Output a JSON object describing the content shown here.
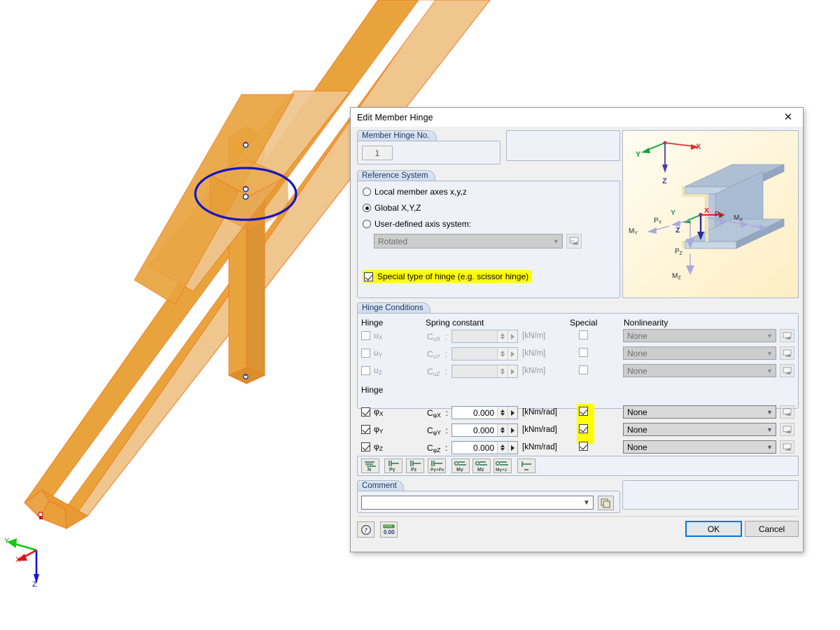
{
  "viewport": {
    "axis_indicator": {
      "x_label": "X",
      "y_label": "Y",
      "z_label": "Z"
    },
    "model": {
      "selection_marker": "blue-ellipse",
      "member_color": "#E8A33D"
    }
  },
  "dialog": {
    "title": "Edit Member Hinge",
    "close_icon": "✕",
    "hinge_no": {
      "label": "Member Hinge No.",
      "value": "1"
    },
    "reference_system": {
      "label": "Reference System",
      "options": [
        {
          "label": "Local member axes x,y,z",
          "selected": false
        },
        {
          "label": "Global X,Y,Z",
          "selected": true
        },
        {
          "label": "User-defined axis system:",
          "selected": false
        }
      ],
      "axis_select": {
        "value": "Rotated",
        "enabled": false
      },
      "special_hinge": {
        "label": "Special type of hinge (e.g. scissor hinge)",
        "checked": true,
        "highlight": "#ffff00"
      }
    },
    "graphic": {
      "axes": [
        {
          "label": "X",
          "color": "#e03030"
        },
        {
          "label": "Y",
          "color": "#13a03c"
        },
        {
          "label": "Z",
          "color": "#4b3ea8"
        }
      ],
      "forces": [
        "P",
        "X",
        "P",
        "Y",
        "P",
        "Z"
      ],
      "labels": [
        {
          "text": "P",
          "sub": "X"
        },
        {
          "text": "P",
          "sub": "Y"
        },
        {
          "text": "P",
          "sub": "Z"
        },
        {
          "text": "M",
          "sub": "X"
        },
        {
          "text": "M",
          "sub": "Y"
        },
        {
          "text": "M",
          "sub": "Z"
        }
      ]
    },
    "hinge_conditions": {
      "label": "Hinge Conditions",
      "columns": {
        "hinge": "Hinge",
        "spring": "Spring constant",
        "special": "Special",
        "nonlinearity": "Nonlinearity"
      },
      "subheader": "Hinge",
      "translation_rows": [
        {
          "dof": "u",
          "sub": "X",
          "checked": false,
          "enabled": false,
          "spring_symbol": "C",
          "spring_sub": "uX",
          "spring_value": "",
          "unit": "[kN/m]",
          "special": false,
          "special_enabled": false,
          "nonlinearity": "None"
        },
        {
          "dof": "u",
          "sub": "Y",
          "checked": false,
          "enabled": false,
          "spring_symbol": "C",
          "spring_sub": "uY",
          "spring_value": "",
          "unit": "[kN/m]",
          "special": false,
          "special_enabled": false,
          "nonlinearity": "None"
        },
        {
          "dof": "u",
          "sub": "Z",
          "checked": false,
          "enabled": false,
          "spring_symbol": "C",
          "spring_sub": "uZ",
          "spring_value": "",
          "unit": "[kN/m]",
          "special": false,
          "special_enabled": false,
          "nonlinearity": "None"
        }
      ],
      "rotation_rows": [
        {
          "dof": "φ",
          "sub": "X",
          "checked": true,
          "enabled": true,
          "spring_symbol": "C",
          "spring_sub": "φX",
          "spring_value": "0.000",
          "unit": "[kNm/rad]",
          "special": true,
          "special_enabled": true,
          "nonlinearity": "None"
        },
        {
          "dof": "φ",
          "sub": "Y",
          "checked": true,
          "enabled": true,
          "spring_symbol": "C",
          "spring_sub": "φY",
          "spring_value": "0.000",
          "unit": "[kNm/rad]",
          "special": true,
          "special_enabled": true,
          "nonlinearity": "None"
        },
        {
          "dof": "φ",
          "sub": "Z",
          "checked": true,
          "enabled": true,
          "spring_symbol": "C",
          "spring_sub": "φZ",
          "spring_value": "0.000",
          "unit": "[kNm/rad]",
          "special": true,
          "special_enabled": true,
          "nonlinearity": "None"
        }
      ],
      "special_highlight_color": "#ffff00"
    },
    "preset_toolbar": [
      {
        "name": "preset-n",
        "label": "N"
      },
      {
        "name": "preset-py",
        "label": "Py"
      },
      {
        "name": "preset-pz",
        "label": "Pz"
      },
      {
        "name": "preset-py-pz",
        "label": "Py+Pz"
      },
      {
        "name": "preset-my",
        "label": "My"
      },
      {
        "name": "preset-mz",
        "label": "Mz"
      },
      {
        "name": "preset-my-mz",
        "label": "My+z"
      },
      {
        "name": "preset-none",
        "label": "-"
      }
    ],
    "comment": {
      "label": "Comment",
      "value": "",
      "placeholder": ""
    },
    "footer": {
      "help_icon": "question-mark-icon",
      "units_icon": "units-icon",
      "ok": "OK",
      "cancel": "Cancel"
    }
  }
}
